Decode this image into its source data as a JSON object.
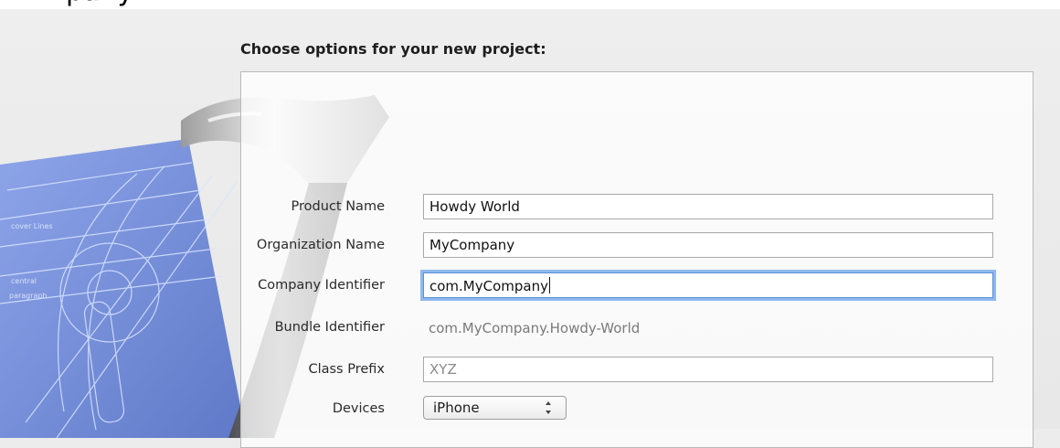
{
  "window": {
    "title_fragment": "pany"
  },
  "sheet": {
    "title": "Choose options for your new project:"
  },
  "form": {
    "product_name": {
      "label": "Product Name",
      "value": "Howdy World"
    },
    "organization_name": {
      "label": "Organization Name",
      "value": "MyCompany"
    },
    "company_identifier": {
      "label": "Company Identifier",
      "value": "com.MyCompany"
    },
    "bundle_identifier": {
      "label": "Bundle Identifier",
      "value": "com.MyCompany.Howdy-World"
    },
    "class_prefix": {
      "label": "Class Prefix",
      "placeholder": "XYZ"
    },
    "devices": {
      "label": "Devices",
      "selected": "iPhone"
    }
  },
  "colors": {
    "focus_ring": "#8fb8ef",
    "blueprint": "#6d88d6",
    "panel_border": "#b9b9b9"
  },
  "icons": {
    "xcode_artwork": "hammer-blueprint-icon",
    "select_arrows": "updown-arrows-icon"
  }
}
